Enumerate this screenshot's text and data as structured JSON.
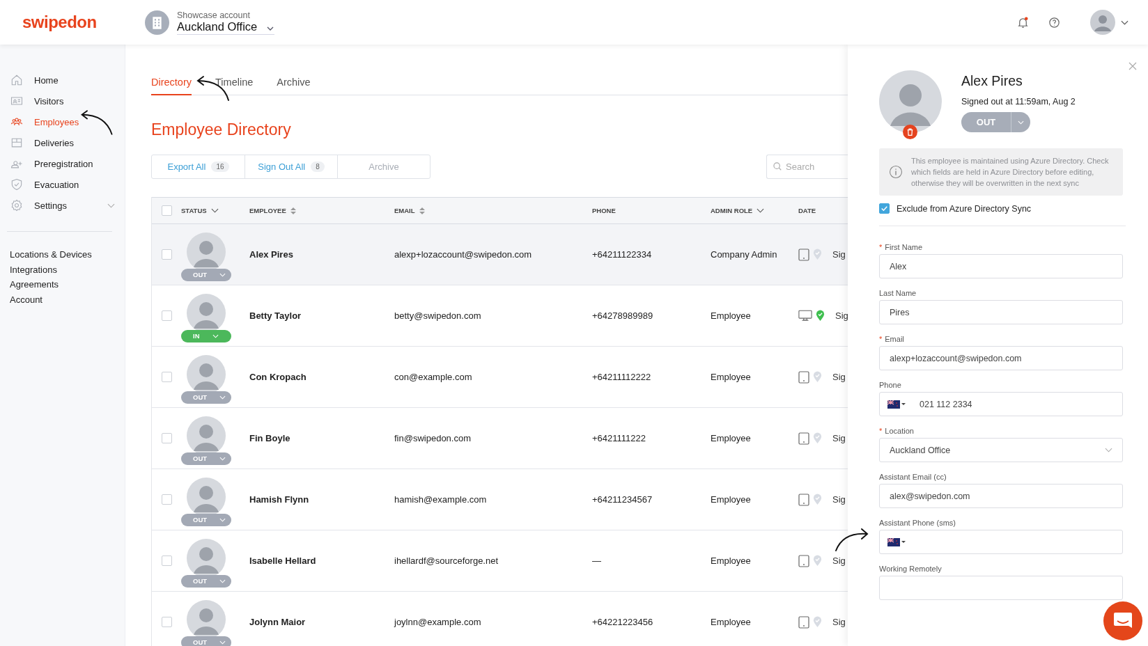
{
  "header": {
    "logo": "swipedon",
    "account_label": "Showcase account",
    "account_name": "Auckland Office",
    "notifications_unread": true
  },
  "sidebar": {
    "items": [
      {
        "label": "Home",
        "selected": false,
        "has_submenu": false
      },
      {
        "label": "Visitors",
        "selected": false,
        "has_submenu": false
      },
      {
        "label": "Employees",
        "selected": true,
        "has_submenu": false
      },
      {
        "label": "Deliveries",
        "selected": false,
        "has_submenu": false
      },
      {
        "label": "Preregistration",
        "selected": false,
        "has_submenu": false
      },
      {
        "label": "Evacuation",
        "selected": false,
        "has_submenu": false
      },
      {
        "label": "Settings",
        "selected": false,
        "has_submenu": true
      }
    ],
    "links": [
      "Locations & Devices",
      "Integrations",
      "Agreements",
      "Account"
    ]
  },
  "tabs": [
    {
      "label": "Directory",
      "selected": true
    },
    {
      "label": "Timeline",
      "selected": false
    },
    {
      "label": "Archive",
      "selected": false
    }
  ],
  "page_title": "Employee Directory",
  "actions": [
    {
      "label": "Export All",
      "count": "16",
      "disabled": false
    },
    {
      "label": "Sign Out All",
      "count": "8",
      "disabled": false
    },
    {
      "label": "Archive",
      "disabled": true
    }
  ],
  "search": {
    "placeholder": "Search"
  },
  "table": {
    "header_checked": false,
    "columns": [
      {
        "label": "STATUS",
        "kind": "filter"
      },
      {
        "label": "EMPLOYEE",
        "kind": "sortable"
      },
      {
        "label": "EMAIL",
        "kind": "sortable"
      },
      {
        "label": "PHONE",
        "kind": "plain"
      },
      {
        "label": "ADMIN ROLE",
        "kind": "filter"
      },
      {
        "label": "DATE",
        "kind": "plain"
      }
    ],
    "rows": [
      {
        "selected": true,
        "checked": false,
        "status": "OUT",
        "signed_in": false,
        "name": "Alex Pires",
        "email": "alexp+lozaccount@swipedon.com",
        "phone": "+64211122334",
        "role": "Company Admin",
        "kind": "tablet",
        "location_verified": false,
        "date": "Sig"
      },
      {
        "selected": false,
        "checked": false,
        "status": "IN",
        "signed_in": true,
        "name": "Betty Taylor",
        "email": "betty@swipedon.com",
        "phone": "+64278989989",
        "role": "Employee",
        "kind": "desktop",
        "location_verified": true,
        "date": "Sig"
      },
      {
        "selected": false,
        "checked": false,
        "status": "OUT",
        "signed_in": false,
        "name": "Con Kropach",
        "email": "con@example.com",
        "phone": "+64211112222",
        "role": "Employee",
        "kind": "tablet",
        "location_verified": false,
        "date": "Sig"
      },
      {
        "selected": false,
        "checked": false,
        "status": "OUT",
        "signed_in": false,
        "name": "Fin Boyle",
        "email": "fin@swipedon.com",
        "phone": "+6421111222",
        "role": "Employee",
        "kind": "tablet",
        "location_verified": false,
        "date": "Sig"
      },
      {
        "selected": false,
        "checked": false,
        "status": "OUT",
        "signed_in": false,
        "name": "Hamish Flynn",
        "email": "hamish@example.com",
        "phone": "+64211234567",
        "role": "Employee",
        "kind": "tablet",
        "location_verified": false,
        "date": "Sig"
      },
      {
        "selected": false,
        "checked": false,
        "status": "OUT",
        "signed_in": false,
        "name": "Isabelle Hellard",
        "email": "ihellardf@sourceforge.net",
        "phone": "—",
        "role": "Employee",
        "kind": "tablet",
        "location_verified": false,
        "date": "Sig"
      },
      {
        "selected": false,
        "checked": false,
        "status": "OUT",
        "signed_in": false,
        "name": "Jolynn Maior",
        "email": "joylnn@example.com",
        "phone": "+64221223456",
        "role": "Employee",
        "kind": "tablet",
        "location_verified": false,
        "date": "Sig"
      }
    ]
  },
  "panel": {
    "name": "Alex Pires",
    "status_line": "Signed out at 11:59am, Aug 2",
    "status_button": "OUT",
    "signed_in": false,
    "notice": "This employee is maintained using Azure Directory. Check which fields are held in Azure Directory before editing, otherwise they will be overwritten in the next sync",
    "exclude_sync": {
      "label": "Exclude from Azure Directory Sync",
      "checked": true
    },
    "fields": [
      {
        "kind": "text",
        "required_marker": "*",
        "label": "First Name",
        "value": "Alex"
      },
      {
        "kind": "text",
        "label": "Last Name",
        "value": "Pires"
      },
      {
        "kind": "text",
        "required_marker": "*",
        "label": "Email",
        "value": "alexp+lozaccount@swipedon.com"
      },
      {
        "kind": "phone",
        "label": "Phone",
        "value": "021 112 2334"
      },
      {
        "kind": "select",
        "required_marker": "*",
        "label": "Location",
        "value": "Auckland Office"
      },
      {
        "kind": "text",
        "label": "Assistant Email (cc)",
        "value": "alex@swipedon.com"
      },
      {
        "kind": "phone",
        "label": "Assistant Phone (sms)"
      },
      {
        "kind": "text",
        "label": "Working Remotely"
      }
    ]
  }
}
